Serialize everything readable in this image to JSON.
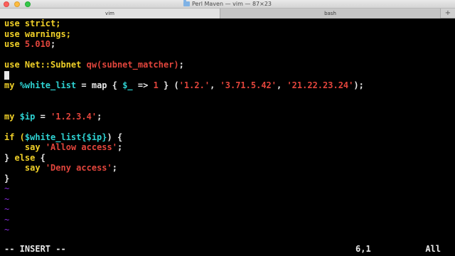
{
  "window": {
    "title": "Perl Maven — vim — 87×23"
  },
  "tabs": [
    {
      "label": "vim"
    },
    {
      "label": "bash"
    }
  ],
  "tab_add_label": "+",
  "code": {
    "l1": {
      "a": "use strict;"
    },
    "l2": {
      "a": "use warnings;"
    },
    "l3": {
      "a": "use ",
      "b": "5.010",
      "c": ";"
    },
    "l4": {
      "a": "use Net::Subnet ",
      "b": "qw(subnet_matcher)",
      "c": ";"
    },
    "l6": {
      "a": "my ",
      "b": "%white_list",
      "c": " = map { ",
      "d": "$_",
      "e": " => ",
      "f": "1",
      "g": " } (",
      "h": "'1.2.'",
      "i": ", ",
      "j": "'3.71.5.42'",
      "k": ", ",
      "l": "'21.22.23.24'",
      "m": ");"
    },
    "l9": {
      "a": "my ",
      "b": "$ip",
      "c": " = ",
      "d": "'1.2.3.4'",
      "e": ";"
    },
    "l11": {
      "a": "if (",
      "b": "$white_list{$ip}",
      "c": ") {"
    },
    "l12": {
      "a": "    ",
      "b": "say",
      "c": " ",
      "d": "'Allow access'",
      "e": ";"
    },
    "l13": {
      "a": "} ",
      "b": "else",
      "c": " {"
    },
    "l14": {
      "a": "    ",
      "b": "say",
      "c": " ",
      "d": "'Deny access'",
      "e": ";"
    },
    "l15": {
      "a": "}"
    }
  },
  "tilde_char": "~",
  "status": {
    "mode": "-- INSERT --",
    "position": "6,1",
    "scroll": "All"
  }
}
